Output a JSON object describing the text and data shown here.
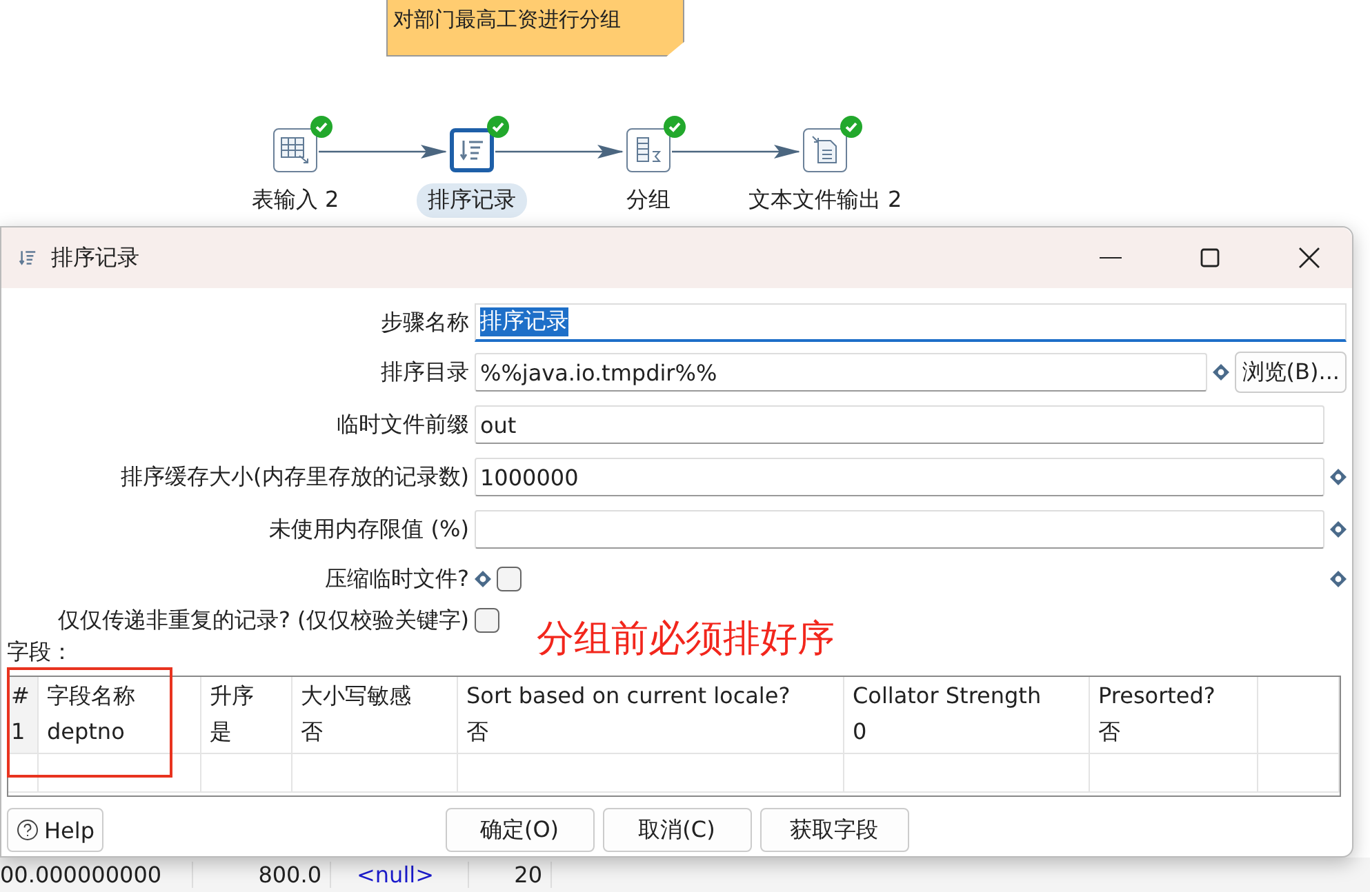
{
  "canvas": {
    "note": "对部门最高工资进行分组",
    "steps": [
      {
        "label": "表输入 2",
        "kind": "table",
        "selected": false,
        "ok": true
      },
      {
        "label": "排序记录",
        "kind": "sort",
        "selected": true,
        "ok": true
      },
      {
        "label": "分组",
        "kind": "group",
        "selected": false,
        "ok": true
      },
      {
        "label": "文本文件输出 2",
        "kind": "file",
        "selected": false,
        "ok": true
      }
    ]
  },
  "background_row": [
    "00.000000000",
    "800.0",
    "<null>",
    "20"
  ],
  "dialog": {
    "title": "排序记录",
    "fields": [
      {
        "kind": "text",
        "label": "步骤名称",
        "value": "排序记录",
        "focused": true,
        "variable": false
      },
      {
        "kind": "text",
        "label": "排序目录",
        "value": "%%java.io.tmpdir%%",
        "variable": true,
        "button": "浏览(B)..."
      },
      {
        "kind": "text",
        "label": "临时文件前缀",
        "value": "out",
        "variable": false
      },
      {
        "kind": "text",
        "label": "排序缓存大小(内存里存放的记录数)",
        "value": "1000000",
        "variable": true
      },
      {
        "kind": "text",
        "label": "未使用内存限值 (%)",
        "variable": true
      },
      {
        "kind": "checkbox",
        "label": "压缩临时文件?",
        "checked": false,
        "variable": true
      },
      {
        "kind": "checkbox",
        "label": "仅仅传递非重复的记录? (仅仅校验关键字)",
        "checked": false,
        "variable": false
      }
    ],
    "annotation": "分组前必须排好序",
    "table_label": "字段：",
    "table": {
      "columns": [
        "#",
        "字段名称",
        "升序",
        "大小写敏感",
        "Sort based on current locale?",
        "Collator Strength",
        "Presorted?"
      ],
      "rows": [
        [
          "1",
          "deptno",
          "是",
          "否",
          "否",
          "0",
          "否"
        ]
      ]
    },
    "help": "Help",
    "buttons": [
      "确定(O)",
      "取消(C)",
      "获取字段"
    ]
  }
}
